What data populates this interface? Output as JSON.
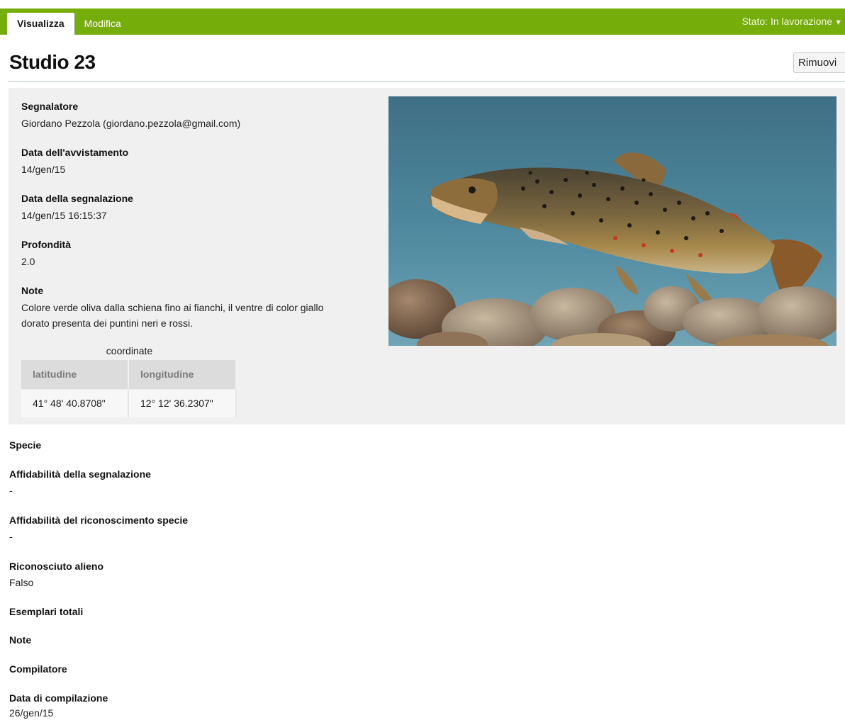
{
  "tabs": [
    {
      "label": "Visualizza",
      "active": true
    },
    {
      "label": "Modifica",
      "active": false
    }
  ],
  "status_menu": {
    "label": "Stato: In lavorazione",
    "caret": "▼"
  },
  "page_title": "Studio 23",
  "remove_button": "Rimuovi",
  "colors": {
    "topbar": "#75ad0a",
    "panel": "#f0f0f0",
    "table_header": "#dcdcdc"
  },
  "report": {
    "reporter": {
      "label": "Segnalatore",
      "value": "Giordano Pezzola (giordano.pezzola@gmail.com)"
    },
    "sighting_date": {
      "label": "Data dell'avvistamento",
      "value": "14/gen/15"
    },
    "report_date": {
      "label": "Data della segnalazione",
      "value": "14/gen/15 16:15:37"
    },
    "depth": {
      "label": "Profondità",
      "value": "2.0"
    },
    "note": {
      "label": "Note",
      "value": "Colore verde oliva dalla schiena fino ai fianchi, il ventre di color giallo dorato presenta dei puntini neri e rossi."
    }
  },
  "coordinates": {
    "caption": "coordinate",
    "headers": [
      "latitudine",
      "longitudine"
    ],
    "row": [
      "41° 48' 40.8708\"",
      "12° 12' 36.2307\""
    ]
  },
  "photo": {
    "icon": "fish-photo"
  },
  "details": [
    {
      "label": "Specie",
      "value": ""
    },
    {
      "label": "Affidabilità della segnalazione",
      "value": "-"
    },
    {
      "label": "Affidabilità del riconoscimento specie",
      "value": "-"
    },
    {
      "label": "Riconosciuto alieno",
      "value": "Falso"
    },
    {
      "label": "Esemplari totali",
      "value": ""
    },
    {
      "label": "Note",
      "value": ""
    },
    {
      "label": "Compilatore",
      "value": ""
    },
    {
      "label": "Data di compilazione",
      "value": "26/gen/15"
    }
  ]
}
